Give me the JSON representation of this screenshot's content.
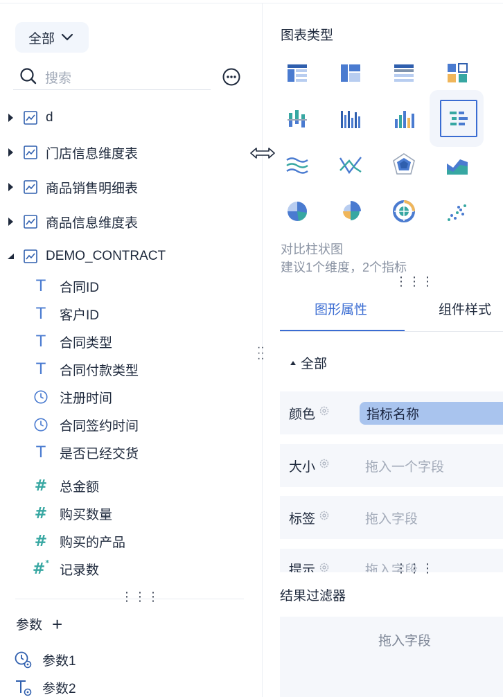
{
  "left": {
    "scope_label": "全部",
    "search_placeholder": "搜索",
    "datasets": [
      {
        "name": "d",
        "expanded": false
      },
      {
        "name": "门店信息维度表",
        "expanded": false
      },
      {
        "name": "商品销售明细表",
        "expanded": false
      },
      {
        "name": "商品信息维度表",
        "expanded": false
      },
      {
        "name": "DEMO_CONTRACT",
        "expanded": true
      }
    ],
    "fields": [
      {
        "name": "合同ID",
        "type": "text"
      },
      {
        "name": "客户ID",
        "type": "text"
      },
      {
        "name": "合同类型",
        "type": "text"
      },
      {
        "name": "合同付款类型",
        "type": "text"
      },
      {
        "name": "注册时间",
        "type": "time"
      },
      {
        "name": "合同签约时间",
        "type": "time"
      },
      {
        "name": "是否已经交货",
        "type": "text"
      },
      {
        "name": "总金额",
        "type": "number"
      },
      {
        "name": "购买数量",
        "type": "number"
      },
      {
        "name": "购买的产品",
        "type": "number"
      },
      {
        "name": "记录数",
        "type": "count"
      }
    ],
    "params_title": "参数",
    "params": [
      {
        "name": "参数1",
        "type": "time"
      },
      {
        "name": "参数2",
        "type": "text"
      }
    ]
  },
  "right": {
    "chart_type_title": "图表类型",
    "selected_chart": {
      "name": "对比柱状图",
      "hint": "建议1个维度，2个指标"
    },
    "tabs": [
      "图形属性",
      "组件样式"
    ],
    "active_tab": 0,
    "section_label": "全部",
    "properties": [
      {
        "label": "颜色",
        "value": "指标名称",
        "filled": true
      },
      {
        "label": "大小",
        "value": "拖入一个字段",
        "filled": false
      },
      {
        "label": "标签",
        "value": "拖入字段",
        "filled": false
      },
      {
        "label": "提示",
        "value": "拖入字段",
        "filled": false
      }
    ],
    "filter_title": "结果过滤器",
    "filter_placeholder": "拖入字段"
  },
  "colors": {
    "accent": "#3a6cd2",
    "chip": "#a9c4ee",
    "panel_bg": "#f5f7fb"
  }
}
